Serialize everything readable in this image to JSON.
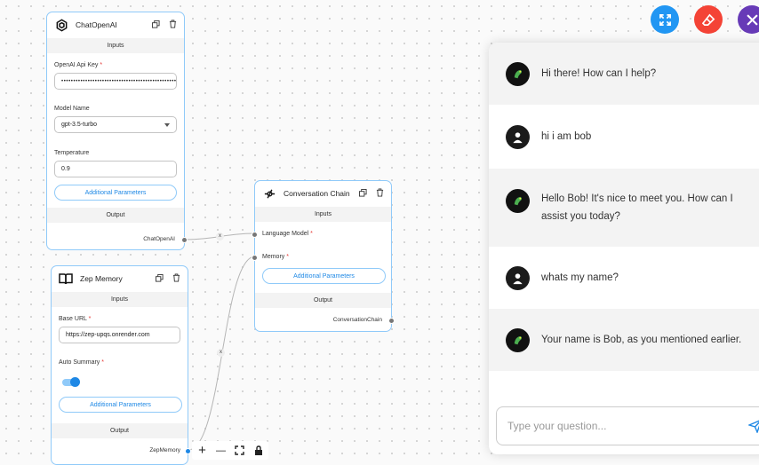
{
  "chatopenai": {
    "title": "ChatOpenAI",
    "inputs_label": "Inputs",
    "api_key_label": "OpenAI Api Key",
    "api_key_value": "••••••••••••••••••••••••••••••••••••••••••••••••••",
    "model_label": "Model Name",
    "model_value": "gpt-3.5-turbo",
    "temperature_label": "Temperature",
    "temperature_value": "0.9",
    "additional_params": "Additional Parameters",
    "output_label": "Output",
    "output_name": "ChatOpenAI"
  },
  "zep": {
    "title": "Zep Memory",
    "inputs_label": "Inputs",
    "base_url_label": "Base URL",
    "base_url_value": "https://zep-upqs.onrender.com",
    "auto_summary_label": "Auto Summary",
    "auto_summary_on": true,
    "additional_params": "Additional Parameters",
    "output_label": "Output",
    "output_name": "ZepMemory"
  },
  "chain": {
    "title": "Conversation Chain",
    "inputs_label": "Inputs",
    "lm_label": "Language Model",
    "memory_label": "Memory",
    "additional_params": "Additional Parameters",
    "output_label": "Output",
    "output_name": "ConversationChain"
  },
  "required_mark": "*",
  "edge_label": "x",
  "chat": {
    "messages": [
      {
        "role": "bot",
        "text": "Hi there! How can I help?"
      },
      {
        "role": "user",
        "text": "hi i am bob"
      },
      {
        "role": "bot",
        "text": "Hello Bob! It's nice to meet you. How can I assist you today?"
      },
      {
        "role": "user",
        "text": "whats my name?"
      },
      {
        "role": "bot",
        "text": "Your name is Bob, as you mentioned earlier."
      }
    ],
    "input_placeholder": "Type your question..."
  },
  "canvas_controls": {
    "zoom_in": "+",
    "zoom_out": "—"
  },
  "colors": {
    "accent": "#1e88e5",
    "expand_fab": "#2196f3",
    "clear_fab": "#f44336",
    "close_fab": "#673ab7"
  }
}
